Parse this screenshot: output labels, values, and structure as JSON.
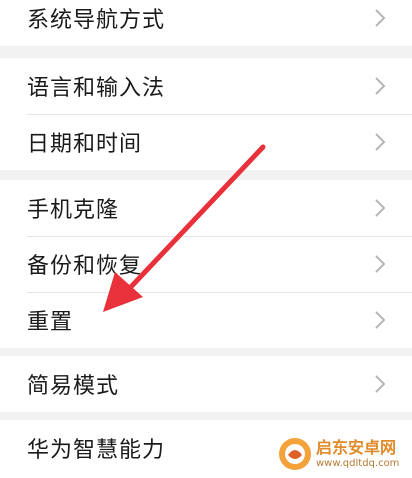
{
  "settings": {
    "group1": [
      {
        "label": "系统导航方式"
      }
    ],
    "group2": [
      {
        "label": "语言和输入法"
      },
      {
        "label": "日期和时间"
      }
    ],
    "group3": [
      {
        "label": "手机克隆"
      },
      {
        "label": "备份和恢复"
      },
      {
        "label": "重置"
      }
    ],
    "group4": [
      {
        "label": "简易模式"
      }
    ],
    "group5": [
      {
        "label": "华为智慧能力"
      }
    ]
  },
  "annotation": {
    "arrow_color": "#e8313a"
  },
  "watermark": {
    "name": "启东安卓网",
    "url": "www.qdltdq.com",
    "color": "#e08a2a"
  }
}
